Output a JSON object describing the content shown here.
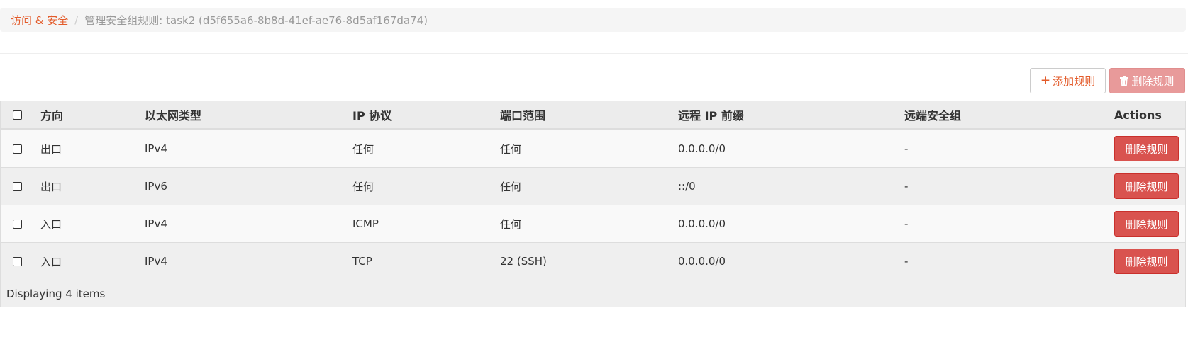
{
  "breadcrumb": {
    "section": "访问 & 安全",
    "separator": "/",
    "current": "管理安全组规则: task2 (d5f655a6-8b8d-41ef-ae76-8d5af167da74)"
  },
  "toolbar": {
    "add_label": "添加规则",
    "add_icon": "plus-icon",
    "delete_label": "删除规则",
    "delete_icon": "trash-icon"
  },
  "table": {
    "columns": [
      "方向",
      "以太网类型",
      "IP 协议",
      "端口范围",
      "远程 IP 前缀",
      "远端安全组",
      "Actions"
    ],
    "rows": [
      {
        "direction": "出口",
        "ethertype": "IPv4",
        "protocol": "任何",
        "port_range": "任何",
        "remote_ip": "0.0.0.0/0",
        "remote_group": "-",
        "action": "删除规则"
      },
      {
        "direction": "出口",
        "ethertype": "IPv6",
        "protocol": "任何",
        "port_range": "任何",
        "remote_ip": "::/0",
        "remote_group": "-",
        "action": "删除规则"
      },
      {
        "direction": "入口",
        "ethertype": "IPv4",
        "protocol": "ICMP",
        "port_range": "任何",
        "remote_ip": "0.0.0.0/0",
        "remote_group": "-",
        "action": "删除规则"
      },
      {
        "direction": "入口",
        "ethertype": "IPv4",
        "protocol": "TCP",
        "port_range": "22 (SSH)",
        "remote_ip": "0.0.0.0/0",
        "remote_group": "-",
        "action": "删除规则"
      }
    ],
    "footer": "Displaying 4 items"
  },
  "colors": {
    "accent": "#e35b2a",
    "danger": "#d9534f",
    "danger_disabled": "#e89a9a"
  }
}
